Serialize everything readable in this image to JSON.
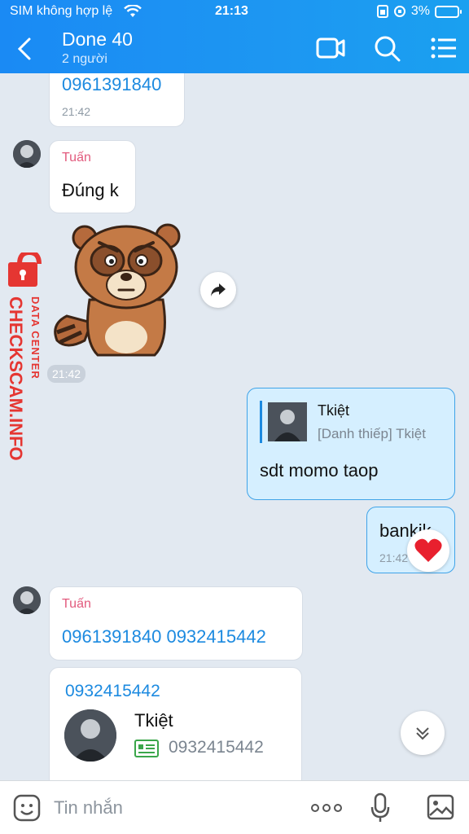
{
  "status": {
    "carrier": "SIM không hợp lệ",
    "time": "21:13",
    "battery": "3%"
  },
  "header": {
    "title": "Done 40",
    "subtitle": "2 người"
  },
  "messages": {
    "top_phone": "0961391840",
    "top_time": "21:42",
    "sender1": "Tuấn",
    "text1": "Đúng k",
    "sticker_time": "21:42",
    "reply_name": "Tkiệt",
    "reply_preview": "[Danh thiếp] Tkiệt",
    "text2": "sdt momo taop",
    "text3": "bankik",
    "text3_time": "21:42",
    "sender2": "Tuấn",
    "text4": "0961391840 0932415442",
    "card_phone": "0932415442",
    "card_name": "Tkiệt",
    "card_number": "0932415442"
  },
  "watermark": {
    "line1": "DATA CENTER",
    "line2": "CHECKSCAM.INFO"
  },
  "composer": {
    "placeholder": "Tin nhắn"
  },
  "colors": {
    "header": "#1d97f2",
    "link": "#1c8ae0",
    "name": "#e25a7d",
    "me_bubble": "#d5efff",
    "watermark": "#e53632"
  }
}
